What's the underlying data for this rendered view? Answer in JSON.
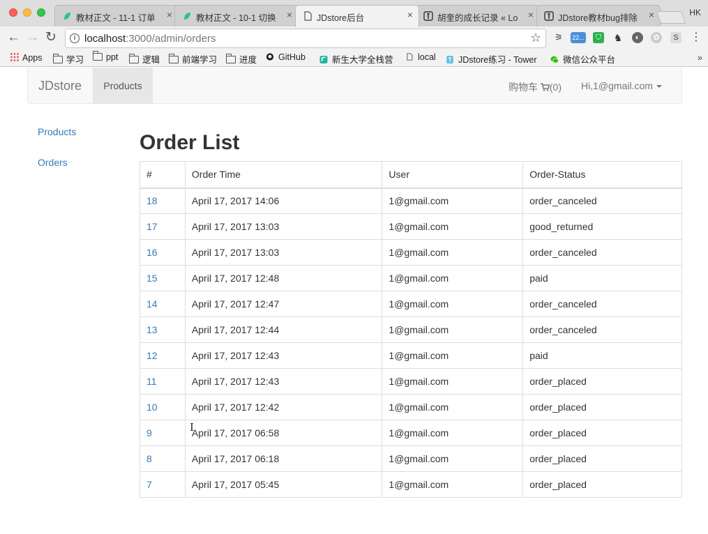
{
  "browser": {
    "profile": "HK",
    "tabs": [
      {
        "title": "教材正文 - 11-1 订单",
        "favicon": "leaf-icon"
      },
      {
        "title": "教材正文 - 10-1 切换",
        "favicon": "leaf-icon"
      },
      {
        "title": "JDstore后台",
        "favicon": "page-icon"
      },
      {
        "title": "胡奎的成长记录 « Lo",
        "favicon": "tower-icon"
      },
      {
        "title": "JDstore教材bug排除",
        "favicon": "tower-icon"
      }
    ],
    "url_host": "localhost",
    "url_path": ":3000/admin/orders",
    "bookmarks": [
      {
        "label": "Apps",
        "icon": "apps-grid-icon"
      },
      {
        "label": "学习",
        "icon": "folder-icon"
      },
      {
        "label": "ppt",
        "icon": "folder-icon"
      },
      {
        "label": "逻辑",
        "icon": "folder-icon"
      },
      {
        "label": "前端学习",
        "icon": "folder-icon"
      },
      {
        "label": "进度",
        "icon": "folder-icon"
      },
      {
        "label": "GitHub",
        "icon": "github-icon"
      },
      {
        "label": "新生大学全栈营",
        "icon": "xinsheng-icon"
      },
      {
        "label": "local",
        "icon": "page-icon"
      },
      {
        "label": "JDstore练习 - Tower",
        "icon": "tower-icon"
      },
      {
        "label": "微信公众平台",
        "icon": "wechat-icon"
      }
    ],
    "ext_badge": "22..."
  },
  "navbar": {
    "brand": "JDstore",
    "products": "Products",
    "cart": "购物车",
    "cart_count": "(0)",
    "user": "Hi,1@gmail.com"
  },
  "sidebar": {
    "items": [
      "Products",
      "Orders"
    ]
  },
  "main": {
    "title": "Order List",
    "columns": [
      "#",
      "Order Time",
      "User",
      "Order-Status"
    ],
    "rows": [
      {
        "id": "18",
        "time": "April 17, 2017 14:06",
        "user": "1@gmail.com",
        "status": "order_canceled"
      },
      {
        "id": "17",
        "time": "April 17, 2017 13:03",
        "user": "1@gmail.com",
        "status": "good_returned"
      },
      {
        "id": "16",
        "time": "April 17, 2017 13:03",
        "user": "1@gmail.com",
        "status": "order_canceled"
      },
      {
        "id": "15",
        "time": "April 17, 2017 12:48",
        "user": "1@gmail.com",
        "status": "paid"
      },
      {
        "id": "14",
        "time": "April 17, 2017 12:47",
        "user": "1@gmail.com",
        "status": "order_canceled"
      },
      {
        "id": "13",
        "time": "April 17, 2017 12:44",
        "user": "1@gmail.com",
        "status": "order_canceled"
      },
      {
        "id": "12",
        "time": "April 17, 2017 12:43",
        "user": "1@gmail.com",
        "status": "paid"
      },
      {
        "id": "11",
        "time": "April 17, 2017 12:43",
        "user": "1@gmail.com",
        "status": "order_placed"
      },
      {
        "id": "10",
        "time": "April 17, 2017 12:42",
        "user": "1@gmail.com",
        "status": "order_placed"
      },
      {
        "id": "9",
        "time": "April 17, 2017 06:58",
        "user": "1@gmail.com",
        "status": "order_placed"
      },
      {
        "id": "8",
        "time": "April 17, 2017 06:18",
        "user": "1@gmail.com",
        "status": "order_placed"
      },
      {
        "id": "7",
        "time": "April 17, 2017 05:45",
        "user": "1@gmail.com",
        "status": "order_placed"
      }
    ]
  },
  "colors": {
    "link": "#337ab7",
    "navbar_bg": "#f8f8f8",
    "active_nav_bg": "#e7e7e7"
  }
}
